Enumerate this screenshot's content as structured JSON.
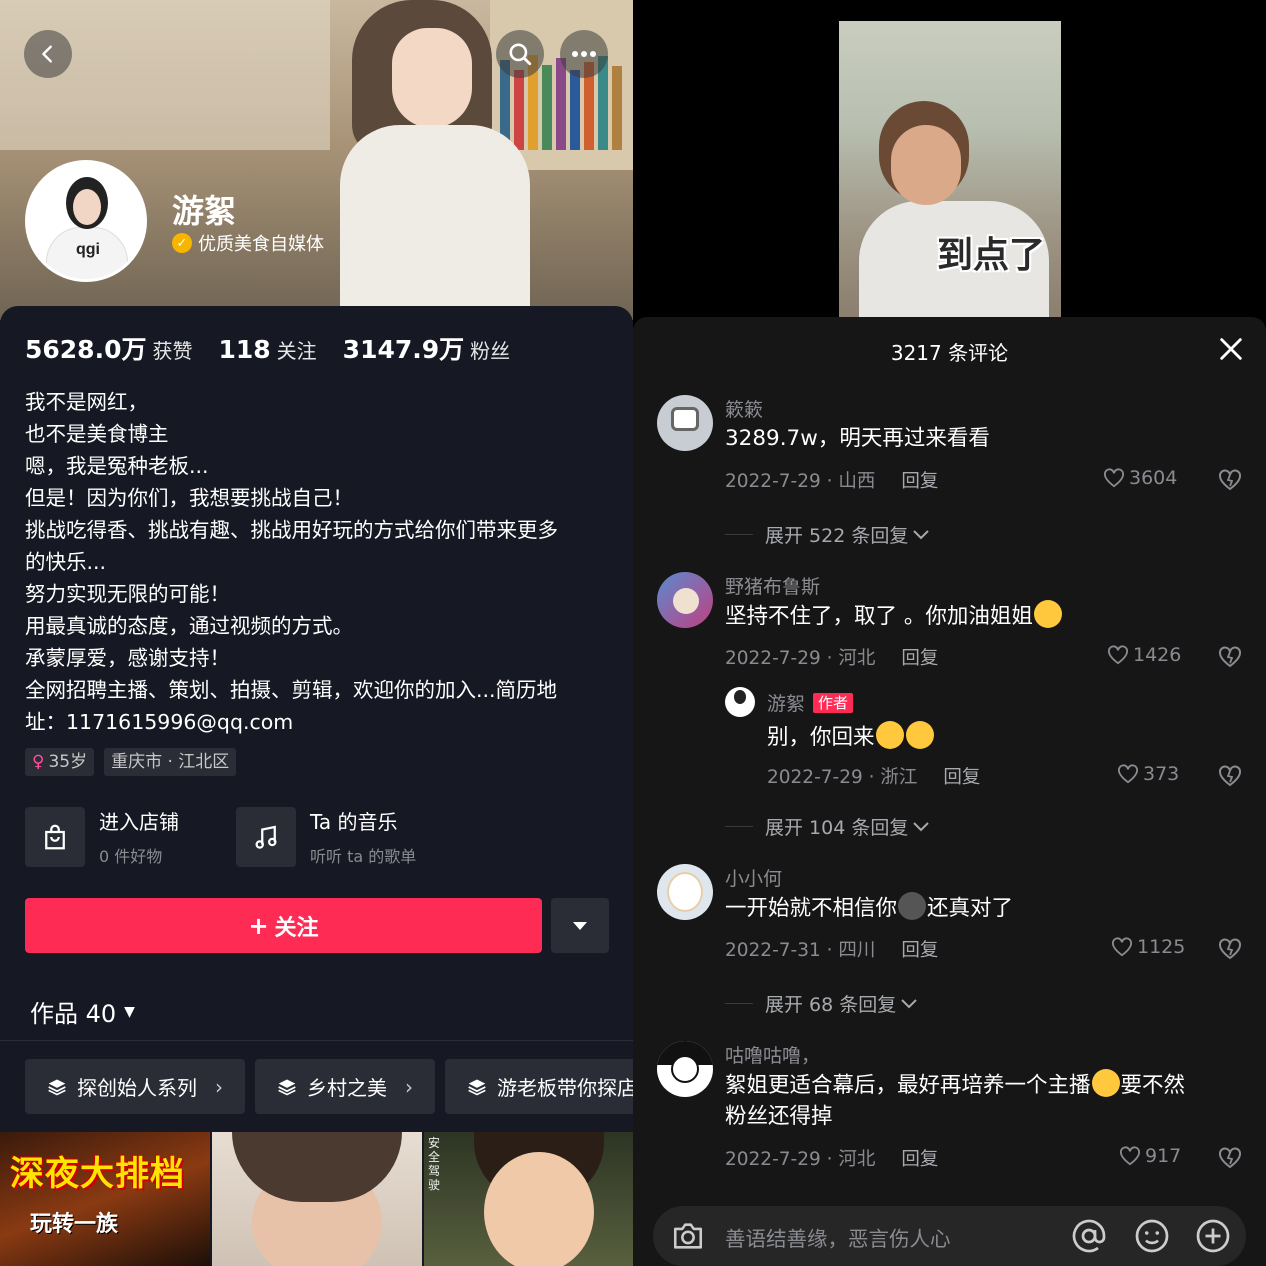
{
  "profile": {
    "name": "游絮",
    "verification": "优质美食自媒体",
    "stats": [
      {
        "value": "5628.0万",
        "label": "获赞"
      },
      {
        "value": "118",
        "label": "关注"
      },
      {
        "value": "3147.9万",
        "label": "粉丝"
      }
    ],
    "bio": [
      "我不是网红，",
      "也不是美食博主",
      "嗯，我是冤种老板...",
      "但是！因为你们，我想要挑战自己！",
      "挑战吃得香、挑战有趣、挑战用好玩的方式给你们带来更多",
      "的快乐...",
      "努力实现无限的可能！",
      "用最真诚的态度，通过视频的方式。",
      "承蒙厚爱，感谢支持！",
      "全网招聘主播、策划、拍摄、剪辑，欢迎你的加入...简历地",
      "址：1171615996@qq.com"
    ],
    "tags": {
      "age": "35岁",
      "age_icon": "female-icon",
      "location": "重庆市 · 江北区"
    },
    "shop": {
      "title": "进入店铺",
      "subtitle": "0 件好物"
    },
    "music": {
      "title": "Ta 的音乐",
      "subtitle": "听听 ta 的歌单"
    },
    "follow_label": "关注",
    "works_label": "作品 40",
    "collections": [
      "探创始人系列",
      "乡村之美",
      "游老板带你探店"
    ],
    "thumb1_title": "深夜大排档",
    "thumb1_sub": "玩转一族",
    "thumb3_side": "安全驾驶"
  },
  "video": {
    "caption": "到点了"
  },
  "comments": {
    "count_label": "3217 条评论",
    "items": [
      {
        "user": "簌簌",
        "text": "3289.7w，明天再过来看看",
        "date": "2022-7-29 · 山西",
        "reply": "回复",
        "likes": "3604",
        "expand": "展开 522 条回复"
      },
      {
        "user": "野猪布鲁斯",
        "text": "坚持不住了，取了 。你加油姐姐",
        "date": "2022-7-29 · 河北",
        "reply": "回复",
        "likes": "1426"
      },
      {
        "user": "游絮",
        "badge": "作者",
        "text": "别，你回来",
        "date": "2022-7-29 · 浙江",
        "reply": "回复",
        "likes": "373",
        "expand": "展开 104 条回复"
      },
      {
        "user": "小小何",
        "text_a": "一开始就不相信你",
        "text_b": "还真对了",
        "date": "2022-7-31 · 四川",
        "reply": "回复",
        "likes": "1125",
        "expand": "展开 68 条回复"
      },
      {
        "user": "咕噜咕噜，",
        "text_a": "絮姐更适合幕后，最好再培养一个主播",
        "text_b": "要不然",
        "text_c": "粉丝还得掉",
        "date": "2022-7-29 · 河北",
        "reply": "回复",
        "likes": "917"
      }
    ],
    "input_placeholder": "善语结善缘，恶言伤人心"
  },
  "colors": {
    "accent": "#fe2c55",
    "verify": "#f7b500",
    "panel": "#161823"
  }
}
